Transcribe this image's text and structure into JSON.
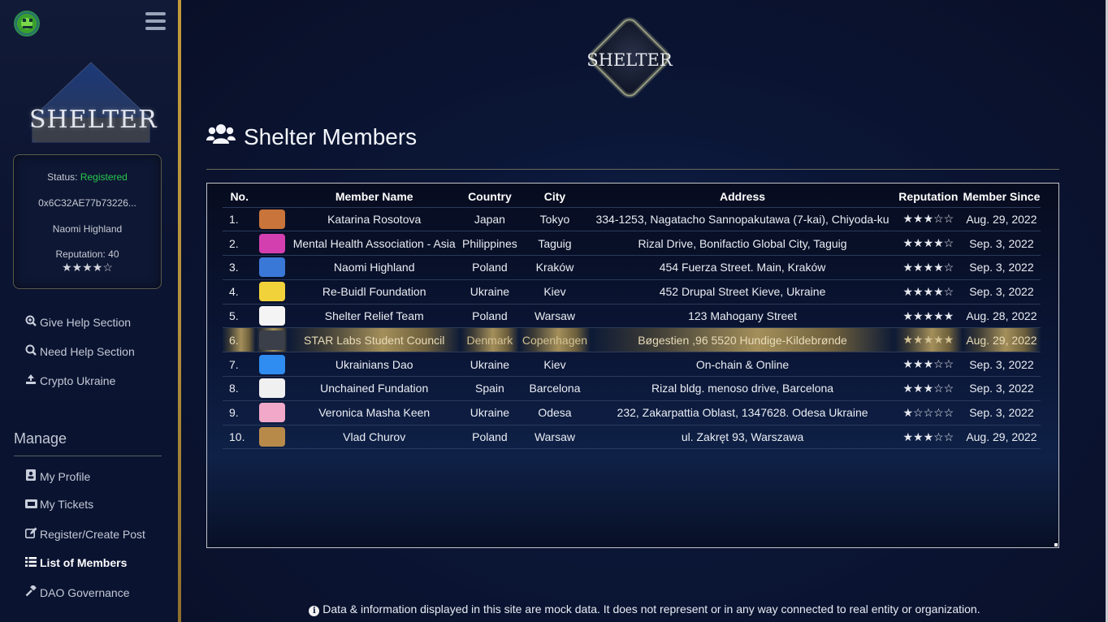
{
  "sidebar": {
    "logo_text": "SHELTER",
    "status": {
      "label": "Status:",
      "value": "Registered",
      "wallet": "0x6C32AE77b73226...",
      "name": "Naomi Highland",
      "reputation_label": "Reputation: 40",
      "stars": "★★★★☆"
    },
    "nav": [
      {
        "label": "Give Help Section",
        "icon": "search-plus-icon"
      },
      {
        "label": "Need Help Section",
        "icon": "search-icon"
      },
      {
        "label": "Crypto Ukraine",
        "icon": "donate-icon"
      }
    ],
    "manage_title": "Manage",
    "manage_items": [
      {
        "label": "My Profile",
        "icon": "profile-icon"
      },
      {
        "label": "My Tickets",
        "icon": "ticket-icon"
      },
      {
        "label": "Register/Create Post",
        "icon": "edit-icon"
      },
      {
        "label": "List of Members",
        "icon": "list-icon",
        "active": true
      },
      {
        "label": "DAO Governance",
        "icon": "gavel-icon"
      }
    ]
  },
  "main": {
    "logo_text": "SHELTER",
    "title": "Shelter Members",
    "table": {
      "headers": [
        "No.",
        "Member Name",
        "Country",
        "City",
        "Address",
        "Reputation",
        "Member Since"
      ],
      "rows": [
        {
          "no": "1.",
          "name": "Katarina Rosotova",
          "country": "Japan",
          "city": "Tokyo",
          "address": "334-1253, Nagatacho Sannopakutawa (7-kai), Chiyoda-ku",
          "stars": "★★★☆☆",
          "since": "Aug. 29, 2022"
        },
        {
          "no": "2.",
          "name": "Mental Health Association - Asia",
          "country": "Philippines",
          "city": "Taguig",
          "address": "Rizal Drive, Bonifactio Global City, Taguig",
          "stars": "★★★★☆",
          "since": "Sep. 3, 2022"
        },
        {
          "no": "3.",
          "name": "Naomi Highland",
          "country": "Poland",
          "city": "Kraków",
          "address": "454 Fuerza Street. Main, Kraków",
          "stars": "★★★★☆",
          "since": "Sep. 3, 2022"
        },
        {
          "no": "4.",
          "name": "Re-Buidl Foundation",
          "country": "Ukraine",
          "city": "Kiev",
          "address": "452 Drupal Street Kieve, Ukraine",
          "stars": "★★★★☆",
          "since": "Sep. 3, 2022"
        },
        {
          "no": "5.",
          "name": "Shelter Relief Team",
          "country": "Poland",
          "city": "Warsaw",
          "address": "123 Mahogany Street",
          "stars": "★★★★★",
          "since": "Aug. 28, 2022"
        },
        {
          "no": "6.",
          "name": "STAR Labs Student Council",
          "country": "Denmark",
          "city": "Copenhagen",
          "address": "Bøgestien ,96 5520 Hundige-Kildebrønde",
          "stars": "★★★★★",
          "since": "Aug. 29, 2022"
        },
        {
          "no": "7.",
          "name": "Ukrainians Dao",
          "country": "Ukraine",
          "city": "Kiev",
          "address": "On-chain & Online",
          "stars": "★★★☆☆",
          "since": "Sep. 3, 2022"
        },
        {
          "no": "8.",
          "name": "Unchained Fundation",
          "country": "Spain",
          "city": "Barcelona",
          "address": "Rizal bldg. menoso drive, Barcelona",
          "stars": "★★★☆☆",
          "since": "Sep. 3, 2022"
        },
        {
          "no": "9.",
          "name": "Veronica Masha Keen",
          "country": "Ukraine",
          "city": "Odesa",
          "address": "232, Zakarpattia Oblast, 1347628. Odesa Ukraine",
          "stars": "★☆☆☆☆",
          "since": "Sep. 3, 2022"
        },
        {
          "no": "10.",
          "name": "Vlad Churov",
          "country": "Poland",
          "city": "Warsaw",
          "address": "ul. Zakręt 93, Warszawa",
          "stars": "★★★☆☆",
          "since": "Aug. 29, 2022"
        }
      ],
      "avatar_colors": [
        "#c9743a",
        "#d43fb0",
        "#3a78d8",
        "#f2d23a",
        "#f4f4f4",
        "#3b3f4a",
        "#2f8cf0",
        "#f0f0f0",
        "#f2a8c8",
        "#b88a4a"
      ],
      "highlight_row": 6
    },
    "footer": "Data & information displayed in this site are mock data. It does not represent or in any way connected to real entity or organization."
  }
}
